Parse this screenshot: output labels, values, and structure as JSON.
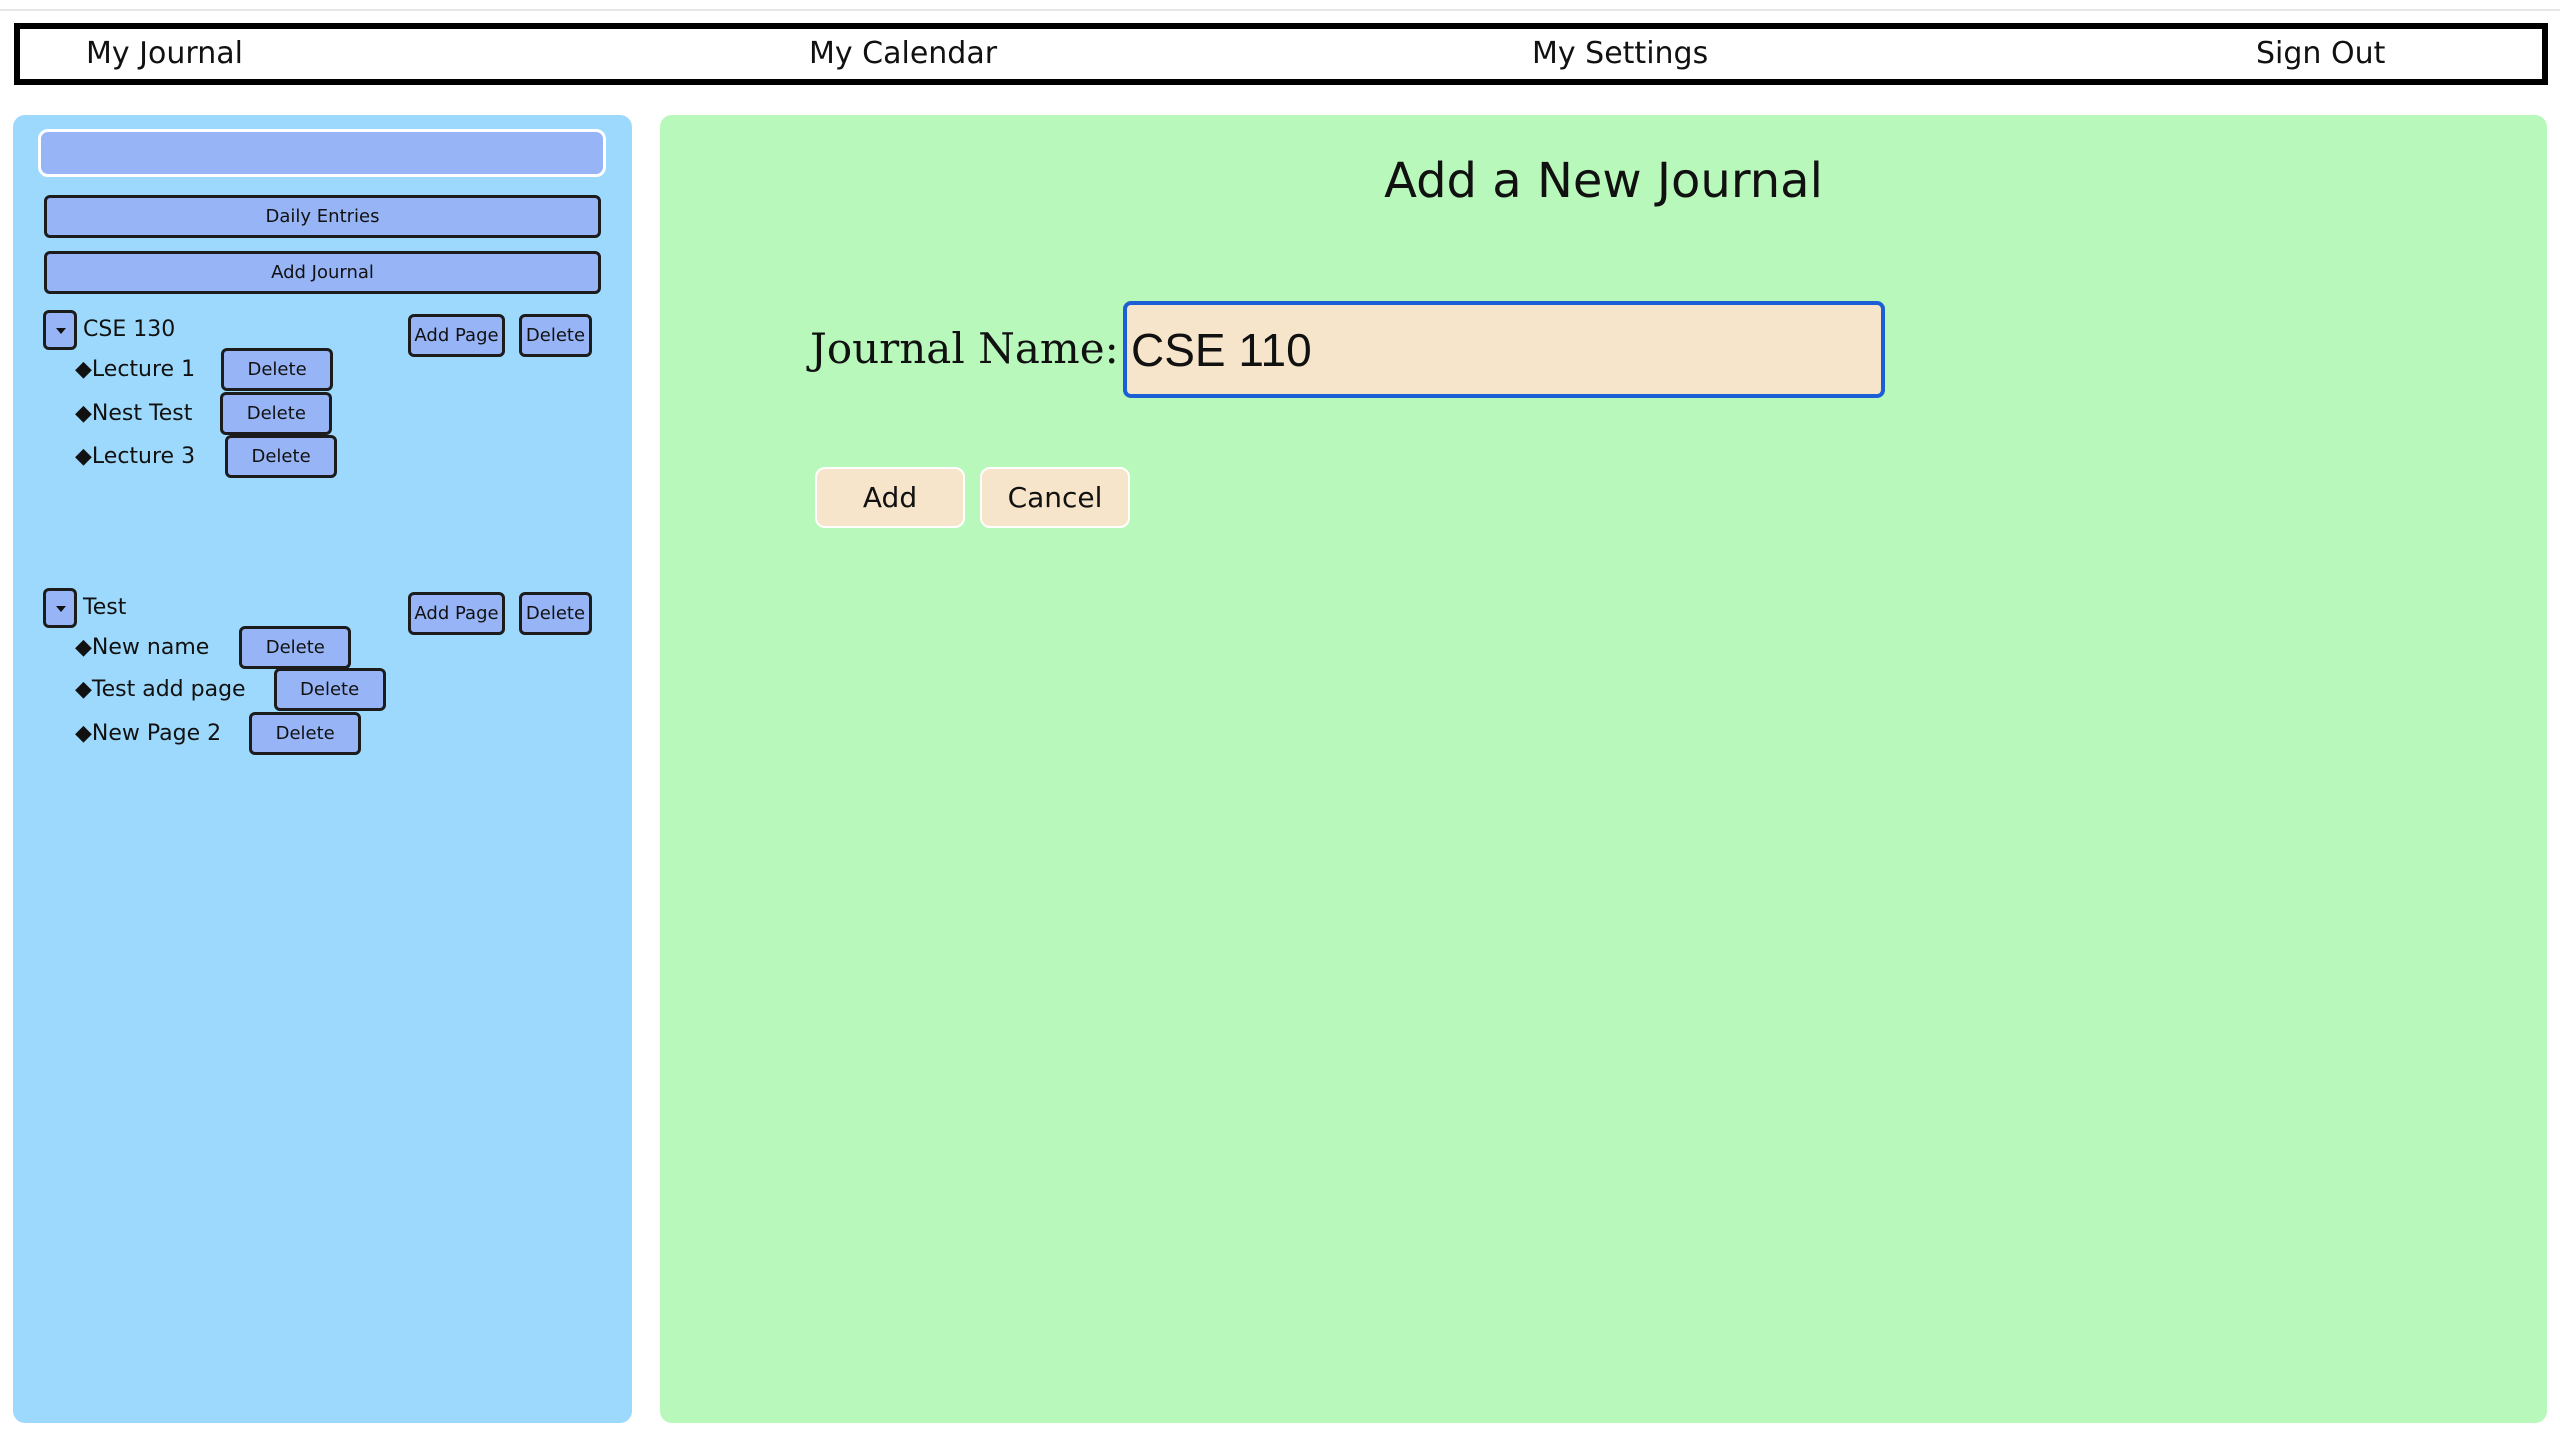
{
  "nav": {
    "journal": "My Journal",
    "calendar": "My Calendar",
    "settings": "My Settings",
    "signout": "Sign Out"
  },
  "sidebar": {
    "search_value": "",
    "daily_entries_label": "Daily Entries",
    "add_journal_label": "Add Journal",
    "add_page_label": "Add Page",
    "delete_label": "Delete",
    "journals": [
      {
        "title": "CSE 130",
        "pages": [
          "◆Lecture 1",
          "◆Nest Test",
          "◆Lecture 3"
        ]
      },
      {
        "title": "Test",
        "pages": [
          "◆New name",
          "◆Test add page",
          "◆New Page 2"
        ]
      }
    ]
  },
  "main": {
    "title": "Add a New Journal",
    "field_label": "Journal Name:",
    "input_value": "CSE 110",
    "add_label": "Add",
    "cancel_label": "Cancel"
  },
  "colors": {
    "sidebar_bg": "#9dd9fc",
    "button_bg": "#96b4f6",
    "main_bg": "#b8f8bb",
    "input_bg": "#f6e5cb",
    "input_border": "#1c5fd4"
  }
}
